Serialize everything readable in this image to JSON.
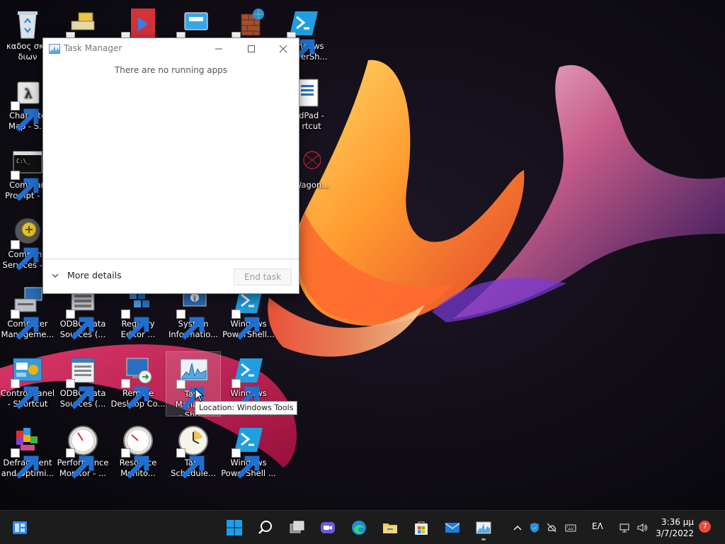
{
  "desktop": {
    "icons": [
      {
        "label": "κάδος ανακύκλωσης\nδιων",
        "display": "καδος σκο\nδιων"
      },
      {
        "label": "Character Map - S...",
        "display": "Characte\nMap - S..."
      },
      {
        "label": "Command Prompt - ...",
        "display": "Comman\nPrompt - ..."
      },
      {
        "label": "Component Services - ...",
        "display": "Compone\nServices - ..."
      },
      {
        "label": "Computer Manageme...",
        "display": "Computer\nManageme..."
      },
      {
        "label": "Control Panel - Shortcut",
        "display": "Control Panel\n- Shortcut"
      },
      {
        "label": "Defragment and Optimi...",
        "display": "Defragment\nand Optimi..."
      },
      {
        "label": "ODBC Data Sources (...",
        "display": "ODBC Data\nSources (..."
      },
      {
        "label": "ODBC Data Sources (...",
        "display": "ODBC Data\nSources (..."
      },
      {
        "label": "Performance Monitor - ...",
        "display": "Performance\nMonitor - ..."
      },
      {
        "label": "Registry Editor ...",
        "display": "Registry\nEditor ..."
      },
      {
        "label": "Remote Desktop Co...",
        "display": "Remote\nDesktop Co..."
      },
      {
        "label": "Resource Monito...",
        "display": "Resource\nMonito..."
      },
      {
        "label": "System Informatio...",
        "display": "System\nInformatio..."
      },
      {
        "label": "Task Manager - Sho...",
        "display": "Task Manager\n- Sho..."
      },
      {
        "label": "Task Schedule...",
        "display": "Task\nSchedule..."
      },
      {
        "label": "Windows PowerShell...",
        "display": "Windows\nPowerShell..."
      },
      {
        "label": "Windows",
        "display": "Windows"
      },
      {
        "label": "Windows PowerShell ...",
        "display": "Windows\nPowerShell ..."
      },
      {
        "label": "Windows PowerSh...",
        "display": "ndows\nwerSh..."
      },
      {
        "label": "WordPad - Shortcut",
        "display": "dPad -\nrtcut"
      },
      {
        "label": "Wagon...",
        "display": "Wagon..."
      }
    ]
  },
  "task_manager": {
    "title": "Task Manager",
    "empty_message": "There are no running apps",
    "more_details": "More details",
    "end_task": "End task"
  },
  "tooltip": {
    "text": "Location: Windows Tools"
  },
  "taskbar": {
    "language": "ΕΛ",
    "time": "3:36 μμ",
    "date": "3/7/2022",
    "notification_count": "7"
  },
  "colors": {
    "taskbar_bg": "#1c1c1c",
    "accent": "#0078d4",
    "notification_badge": "#e74c3c",
    "powershell_blue": "#1f9fe0"
  }
}
